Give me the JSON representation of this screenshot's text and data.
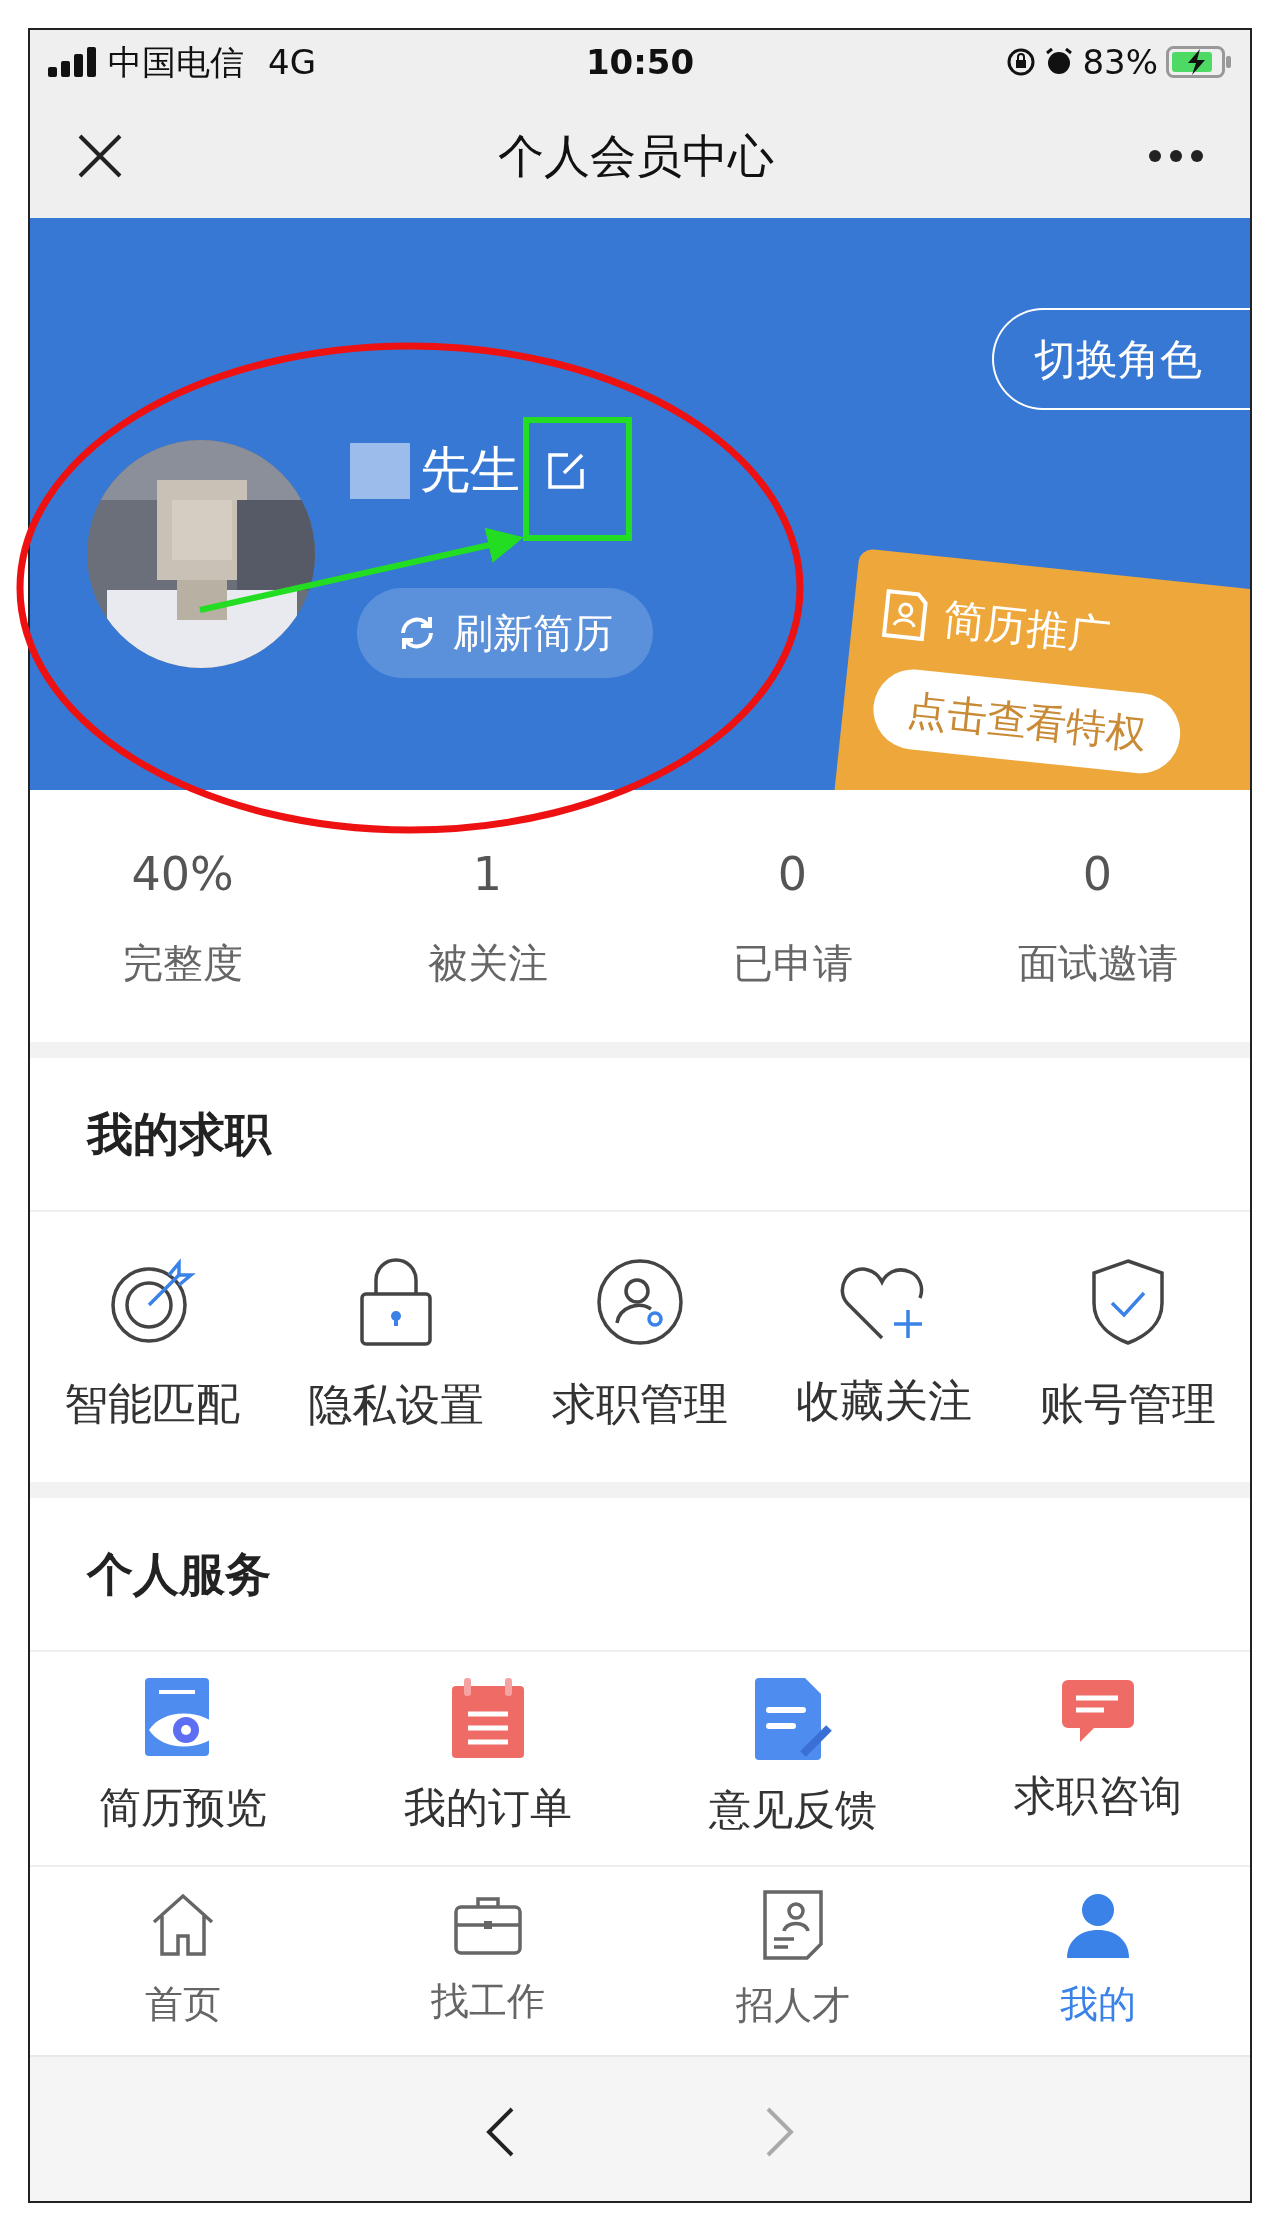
{
  "status_bar": {
    "carrier": "中国电信",
    "network": "4G",
    "time": "10:50",
    "battery": "83%",
    "charging": true
  },
  "nav": {
    "title": "个人会员中心"
  },
  "profile": {
    "name": "先生",
    "refresh_button": "刷新简历",
    "switch_role_button": "切换角色",
    "promo": {
      "title": "简历推广",
      "button": "点击查看特权"
    }
  },
  "stats": [
    {
      "value": "40%",
      "label": "完整度"
    },
    {
      "value": "1",
      "label": "被关注"
    },
    {
      "value": "0",
      "label": "已申请"
    },
    {
      "value": "0",
      "label": "面试邀请"
    }
  ],
  "job_section": {
    "title": "我的求职",
    "items": [
      {
        "label": "智能匹配",
        "kind": "target"
      },
      {
        "label": "隐私设置",
        "kind": "lock"
      },
      {
        "label": "求职管理",
        "kind": "person"
      },
      {
        "label": "收藏关注",
        "kind": "heart"
      },
      {
        "label": "账号管理",
        "kind": "shield"
      }
    ]
  },
  "service_section": {
    "title": "个人服务",
    "items": [
      {
        "label": "简历预览",
        "kind": "preview"
      },
      {
        "label": "我的订单",
        "kind": "order"
      },
      {
        "label": "意见反馈",
        "kind": "feedback"
      },
      {
        "label": "求职咨询",
        "kind": "chat"
      }
    ]
  },
  "tab_bar": [
    {
      "label": "首页",
      "kind": "home",
      "selected": false
    },
    {
      "label": "找工作",
      "kind": "briefcase",
      "selected": false
    },
    {
      "label": "招人才",
      "kind": "resume",
      "selected": false
    },
    {
      "label": "我的",
      "kind": "user",
      "selected": true
    }
  ],
  "browser_bar": {
    "back_disabled": false,
    "forward_disabled": true
  }
}
